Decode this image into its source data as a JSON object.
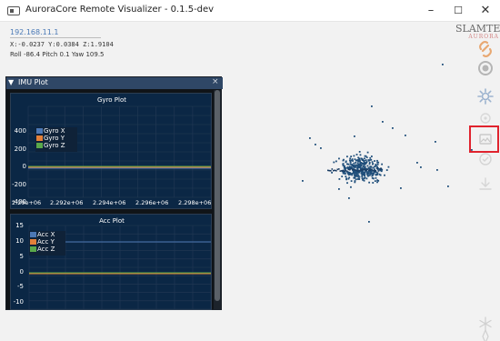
{
  "app": {
    "title": "AuroraCore Remote Visualizer - 0.1.5-dev",
    "window_controls": {
      "minimize": "–",
      "maximize": "☐",
      "close": "✕"
    }
  },
  "info": {
    "ip": "192.168.11.1",
    "position": "X:-0.0237 Y:0.0384 Z:1.9104",
    "orientation": "Roll -86.4 Pitch 0.1 Yaw 109.5"
  },
  "logo": {
    "main": "SLAMTEC",
    "sub": "AURORA"
  },
  "imu_window": {
    "title": "IMU Plot",
    "collapse_glyph": "▼",
    "close_glyph": "×",
    "gyro_plot": {
      "title": "Gyro Plot",
      "y_ticks": [
        "400",
        "200",
        "0",
        "-200",
        "-400"
      ],
      "x_ticks": [
        "2.29e+06",
        "2.292e+06",
        "2.294e+06",
        "2.296e+06",
        "2.298e+06"
      ],
      "legend": [
        {
          "name": "Gyro X",
          "color": "#4c78b5"
        },
        {
          "name": "Gyro Y",
          "color": "#e3803a"
        },
        {
          "name": "Gyro Z",
          "color": "#59a84b"
        }
      ]
    },
    "acc_plot": {
      "title": "Acc Plot",
      "y_ticks": [
        "15",
        "10",
        "5",
        "0",
        "-5",
        "-10"
      ],
      "legend": [
        {
          "name": "Acc X",
          "color": "#4c78b5"
        },
        {
          "name": "Acc Y",
          "color": "#e3803a"
        },
        {
          "name": "Acc Z",
          "color": "#59a84b"
        }
      ]
    }
  },
  "toolbar": {
    "icons": [
      "link-icon",
      "record-icon",
      "settings-icon",
      "map-icon",
      "image-icon",
      "locate-icon",
      "download-icon",
      "snowflake-icon",
      "compass-icon"
    ],
    "highlight_color": "#e0232e"
  },
  "colors": {
    "point_cloud": "#1f4e7a",
    "plot_bg": "#0b2745",
    "title_bar": "#2f4766"
  }
}
